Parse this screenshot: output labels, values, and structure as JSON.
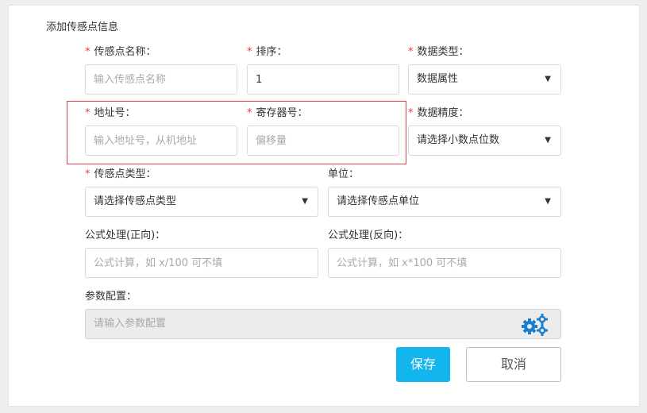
{
  "panel": {
    "title": "添加传感点信息"
  },
  "required_mark": "*",
  "fields": {
    "sensor_name": {
      "label": "传感点名称：",
      "placeholder": "输入传感点名称",
      "value": ""
    },
    "sort": {
      "label": "排序：",
      "placeholder": "",
      "value": "1"
    },
    "data_type": {
      "label": "数据类型：",
      "value": "数据属性"
    },
    "address": {
      "label": "地址号：",
      "placeholder": "输入地址号，从机地址",
      "value": ""
    },
    "register": {
      "label": "寄存器号：",
      "placeholder": "偏移量",
      "value": ""
    },
    "precision": {
      "label": "数据精度：",
      "value": "请选择小数点位数"
    },
    "sensor_type": {
      "label": "传感点类型：",
      "value": "请选择传感点类型"
    },
    "unit": {
      "label": "单位：",
      "value": "请选择传感点单位"
    },
    "formula_forward": {
      "label": "公式处理(正向)：",
      "placeholder": "公式计算，如 x/100 可不填",
      "value": ""
    },
    "formula_reverse": {
      "label": "公式处理(反向)：",
      "placeholder": "公式计算，如 x*100 可不填",
      "value": ""
    },
    "params": {
      "label": "参数配置：",
      "placeholder": "请输入参数配置",
      "value": ""
    }
  },
  "caret": "▼",
  "buttons": {
    "save": "保存",
    "cancel": "取消"
  },
  "icons": {
    "settings": "gears-icon"
  },
  "colors": {
    "accent": "#12b6ec",
    "required": "#e63c3c",
    "highlight": "#d9434e",
    "gears": "#1a7fd1"
  }
}
